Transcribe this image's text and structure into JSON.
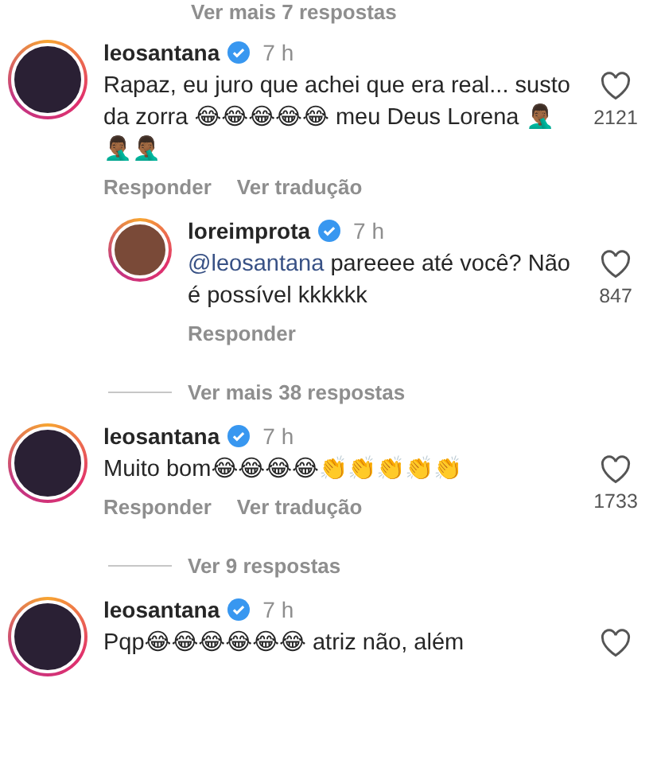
{
  "items": [
    {
      "kind": "more",
      "label": "Ver mais 7 respostas",
      "line": false
    },
    {
      "kind": "comment",
      "user": "leosantana",
      "verified": true,
      "time": "7 h",
      "text": "Rapaz, eu juro que achei que era real... susto da zorra 😂😂😂😂😂 meu Deus Lorena 🤦🏾‍♂️🤦🏾‍♂️🤦🏾‍♂️",
      "likes": "2121",
      "actions": [
        "Responder",
        "Ver tradução"
      ]
    },
    {
      "kind": "reply",
      "user": "loreimprota",
      "verified": true,
      "time": "7 h",
      "mention": "@leosantana",
      "text": " pareeee até você? Não é possível kkkkkk",
      "likes": "847",
      "actions": [
        "Responder"
      ]
    },
    {
      "kind": "more",
      "label": "Ver mais 38 respostas",
      "line": true
    },
    {
      "kind": "comment",
      "user": "leosantana",
      "verified": true,
      "time": "7 h",
      "text": "Muito bom😂😂😂😂👏👏👏👏👏",
      "likes": "1733",
      "actions": [
        "Responder",
        "Ver tradução"
      ]
    },
    {
      "kind": "more",
      "label": "Ver 9 respostas",
      "line": true
    },
    {
      "kind": "comment",
      "user": "leosantana",
      "verified": true,
      "time": "7 h",
      "text": "Pqp😂😂😂😂😂😂 atriz não, além"
    }
  ]
}
